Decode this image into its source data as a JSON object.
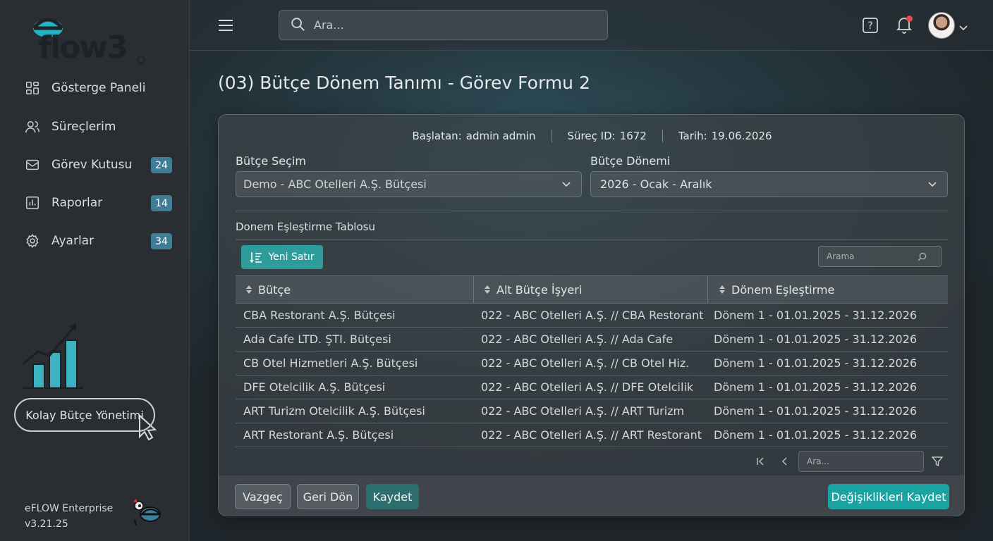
{
  "app": {
    "logo_text": "eflow3",
    "version_name": "eFLOW Enterprise",
    "version_number": "v3.21.25"
  },
  "sidebar": {
    "items": [
      {
        "label": "Gösterge Paneli",
        "icon": "dashboard-icon",
        "badge": null
      },
      {
        "label": "Süreçlerim",
        "icon": "users-icon",
        "badge": null
      },
      {
        "label": "Görev Kutusu",
        "icon": "inbox-icon",
        "badge": "24"
      },
      {
        "label": "Raporlar",
        "icon": "report-icon",
        "badge": "14"
      },
      {
        "label": "Ayarlar",
        "icon": "gear-icon",
        "badge": "34"
      }
    ],
    "promo_label": "Kolay Bütçe Yönetimi"
  },
  "topbar": {
    "search_placeholder": "Ara..."
  },
  "page": {
    "title": "(03) Bütçe Dönem Tanımı - Görev Formu 2"
  },
  "meta": {
    "started_by_label": "Başlatan:",
    "started_by_value": "admin admin",
    "process_id_label": "Süreç ID:",
    "process_id_value": "1672",
    "date_label": "Tarih:",
    "date_value": "19.06.2026"
  },
  "form": {
    "budget_select_label": "Bütçe Seçim",
    "budget_select_value": "Demo -  ABC Otelleri A.Ş. Bütçesi",
    "budget_period_label": "Bütçe Dönemi",
    "budget_period_value": "2026 - Ocak - Aralık"
  },
  "table": {
    "section_title": "Donem Eşleştirme Tablosu",
    "new_row_label": "Yeni Satır",
    "search_placeholder": "Arama",
    "columns": [
      "Bütçe",
      "Alt Bütçe İşyeri",
      "Dönem Eşleştirme"
    ],
    "rows": [
      [
        "CBA Restorant A.Ş. Bütçesi",
        "022 - ABC Otelleri A.Ş. // CBA Restorant",
        "Dönem 1 - 01.01.2025 - 31.12.2026"
      ],
      [
        "Ada Cafe LTD. ŞTI. Bütçesi",
        "022 - ABC Otelleri A.Ş. // Ada Cafe",
        "Dönem 1 - 01.01.2025 - 31.12.2026"
      ],
      [
        "CB Otel Hizmetleri A.Ş. Bütçesi",
        "022 - ABC Otelleri A.Ş. // CB Otel Hiz.",
        "Dönem 1 - 01.01.2025 - 31.12.2026"
      ],
      [
        "DFE Otelcilik A.Ş. Bütçesi",
        "022 - ABC Otelleri A.Ş. // DFE Otelcilik",
        "Dönem 1 - 01.01.2025 - 31.12.2026"
      ],
      [
        "ART Turizm Otelcilik A.Ş. Bütçesi",
        "022 - ABC Otelleri A.Ş. // ART Turizm",
        "Dönem 1 - 01.01.2025 - 31.12.2026"
      ],
      [
        "ART Restorant A.Ş. Bütçesi",
        "022 - ABC Otelleri A.Ş. // ART Restorant",
        "Dönem 1 - 01.01.2025 - 31.12.2026"
      ]
    ],
    "pager_placeholder": "Ara..."
  },
  "footer": {
    "cancel_label": "Vazgeç",
    "back_label": "Geri Dön",
    "save_label": "Kaydet",
    "save_changes_label": "Değişiklikleri Kaydet"
  },
  "colors": {
    "accent": "#1aa3a3",
    "badge": "#3d7d95",
    "notification": "#e8484f"
  }
}
